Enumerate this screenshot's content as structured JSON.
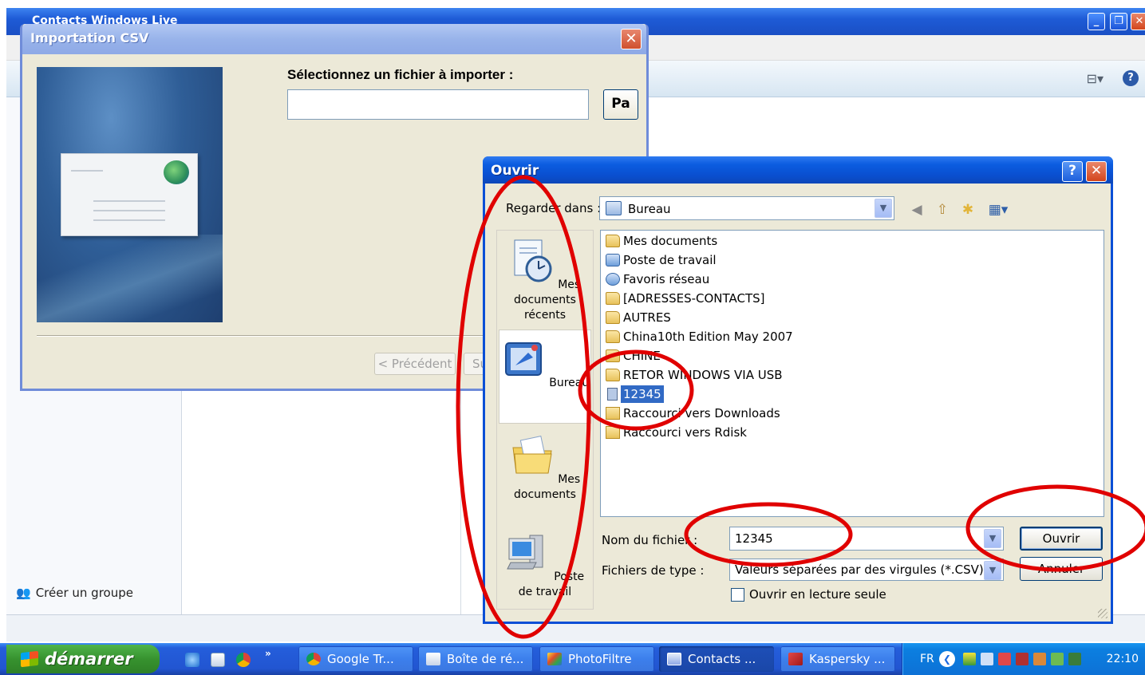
{
  "background_window": {
    "title": "Contacts Windows Live",
    "sidebar": {
      "create_group": "Créer un groupe"
    }
  },
  "import_dialog": {
    "title": "Importation CSV",
    "prompt": "Sélectionnez un fichier à importer :",
    "file_path_value": "",
    "browse_label": "Pa",
    "previous_label": "< Précédent",
    "next_label": "Su"
  },
  "open_dialog": {
    "title": "Ouvrir",
    "help_label": "?",
    "close_label": "✕",
    "look_in_label": "Regarder dans :",
    "look_in_value": "Bureau",
    "places": [
      {
        "label": "Mes documents récents",
        "icon": "recent-documents-icon"
      },
      {
        "label": "Bureau",
        "icon": "desktop-icon"
      },
      {
        "label": "Mes documents",
        "icon": "my-documents-icon"
      },
      {
        "label": "Poste de travail",
        "icon": "my-computer-icon"
      }
    ],
    "files": [
      {
        "name": "Mes documents",
        "icon": "my-documents-icon"
      },
      {
        "name": "Poste de travail",
        "icon": "my-computer-icon"
      },
      {
        "name": "Favoris réseau",
        "icon": "network-icon"
      },
      {
        "name": "[ADRESSES-CONTACTS]",
        "icon": "folder-icon"
      },
      {
        "name": "AUTRES",
        "icon": "folder-icon"
      },
      {
        "name": "China10th Edition May 2007",
        "icon": "folder-icon"
      },
      {
        "name": "CHINE",
        "icon": "folder-icon"
      },
      {
        "name": "RETOR WINDOWS VIA USB",
        "icon": "folder-icon"
      },
      {
        "name": "12345",
        "icon": "csv-file-icon",
        "selected": true
      },
      {
        "name": "Raccourci vers Downloads",
        "icon": "shortcut-icon"
      },
      {
        "name": "Raccourci vers Rdisk",
        "icon": "shortcut-icon"
      }
    ],
    "filename_label": "Nom du fichier :",
    "filename_value": "12345",
    "filetype_label": "Fichiers de type :",
    "filetype_value": "Valeurs séparées par des virgules (*.CSV)",
    "open_button": "Ouvrir",
    "cancel_button": "Annuler",
    "readonly_label": "Ouvrir en lecture seule"
  },
  "taskbar": {
    "start_label": "démarrer",
    "quicklaunch_more": "»",
    "tasks": [
      "Google Tr...",
      "Boîte de ré...",
      "PhotoFiltre",
      "Contacts ...",
      "Kaspersky ..."
    ],
    "language": "FR",
    "clock": "22:10"
  },
  "colors": {
    "xp_title_blue": "#0a4fd6",
    "dialog_face": "#ece9d8",
    "selection": "#316ac5",
    "annotation_red": "#e00000"
  }
}
